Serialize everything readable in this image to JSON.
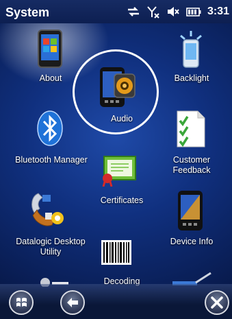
{
  "statusbar": {
    "title": "System",
    "time": "3:31",
    "icons": [
      "sync-arrows-icon",
      "no-signal-icon",
      "speaker-muted-icon",
      "battery-icon"
    ]
  },
  "tiles": {
    "about": "About",
    "backlight": "Backlight",
    "audio": "Audio",
    "bluetooth": "Bluetooth Manager",
    "feedback": "Customer\nFeedback",
    "certificates": "Certificates",
    "datalogic": "Datalogic Desktop\nUtility",
    "device_info": "Device Info",
    "decoding": "Decoding"
  },
  "bottombar": {
    "buttons": [
      "start-button",
      "back-button",
      "close-button"
    ]
  }
}
